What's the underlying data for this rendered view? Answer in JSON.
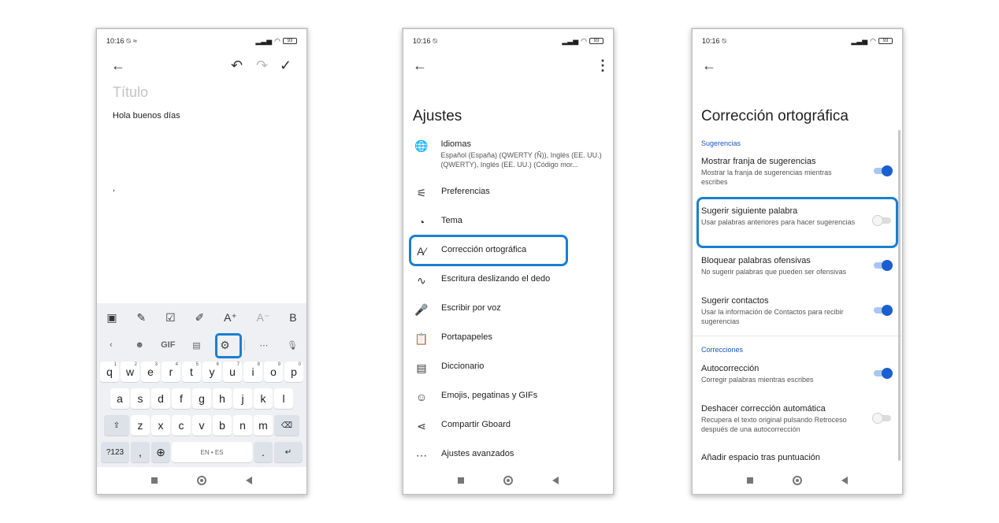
{
  "status": {
    "time": "10:16",
    "battery": "93"
  },
  "phone1": {
    "title_placeholder": "Título",
    "note_text": "Hola buenos días",
    "note_mark": ",",
    "format_tools": [
      "image-icon",
      "pen-icon",
      "checkbox-icon",
      "highlight-icon",
      "text-size-up-icon",
      "text-size-down-icon",
      "bold-icon"
    ],
    "format_labels": {
      "text_up": "A⁺",
      "text_down": "A⁻",
      "bold": "B"
    },
    "kb_tools": {
      "gif": "GIF"
    },
    "row1": [
      [
        "q",
        "1"
      ],
      [
        "w",
        "2"
      ],
      [
        "e",
        "3"
      ],
      [
        "r",
        "4"
      ],
      [
        "t",
        "5"
      ],
      [
        "y",
        "6"
      ],
      [
        "u",
        "7"
      ],
      [
        "i",
        "8"
      ],
      [
        "o",
        "9"
      ],
      [
        "p",
        "0"
      ]
    ],
    "row2": [
      "a",
      "s",
      "d",
      "f",
      "g",
      "h",
      "j",
      "k",
      "l"
    ],
    "row3": [
      "z",
      "x",
      "c",
      "v",
      "b",
      "n",
      "m"
    ],
    "row4": {
      "symbols": "?123",
      "emoji_comma": ",",
      "space": "EN • ES",
      "period": "."
    }
  },
  "phone2": {
    "title": "Ajustes",
    "items": [
      {
        "icon": "globe-icon",
        "glyph": "🌐",
        "label": "Idiomas",
        "sub": "Español (España) (QWERTY (Ñ)), Inglés (EE. UU.) (QWERTY), Inglés (EE. UU.) (Código mor..."
      },
      {
        "icon": "sliders-icon",
        "glyph": "⚟",
        "label": "Preferencias"
      },
      {
        "icon": "palette-icon",
        "glyph": "◔",
        "label": "Tema"
      },
      {
        "icon": "spellcheck-icon",
        "glyph": "A⁄",
        "label": "Corrección ortográfica"
      },
      {
        "icon": "glide-icon",
        "glyph": "∿",
        "label": "Escritura deslizando el dedo"
      },
      {
        "icon": "mic-icon",
        "glyph": "🎤",
        "label": "Escribir por voz"
      },
      {
        "icon": "clipboard-icon",
        "glyph": "📋",
        "label": "Portapapeles"
      },
      {
        "icon": "book-icon",
        "glyph": "▤",
        "label": "Diccionario"
      },
      {
        "icon": "emoji-icon",
        "glyph": "☺",
        "label": "Emojis, pegatinas y GIFs"
      },
      {
        "icon": "share-icon",
        "glyph": "⋖",
        "label": "Compartir Gboard"
      },
      {
        "icon": "more-icon",
        "glyph": "⋯",
        "label": "Ajustes avanzados"
      }
    ]
  },
  "phone3": {
    "title": "Corrección ortográfica",
    "section_suggestions": "Sugerencias",
    "section_corrections": "Correcciones",
    "options": [
      {
        "title": "Mostrar franja de sugerencias",
        "sub": "Mostrar la franja de sugerencias mientras escribes",
        "on": true
      },
      {
        "title": "Sugerir siguiente palabra",
        "sub": "Usar palabras anteriores para hacer sugerencias",
        "on": false
      },
      {
        "title": "Bloquear palabras ofensivas",
        "sub": "No sugerir palabras que pueden ser ofensivas",
        "on": true
      },
      {
        "title": "Sugerir contactos",
        "sub": "Usar la información de Contactos para recibir sugerencias",
        "on": true
      },
      {
        "title": "Autocorrección",
        "sub": "Corregir palabras mientras escribes",
        "on": true
      },
      {
        "title": "Deshacer corrección automática",
        "sub": "Recupera el texto original pulsando Retroceso después de una autocorrección",
        "on": false
      },
      {
        "title": "Añadir espacio tras puntuación",
        "sub": "",
        "on": false
      }
    ]
  }
}
